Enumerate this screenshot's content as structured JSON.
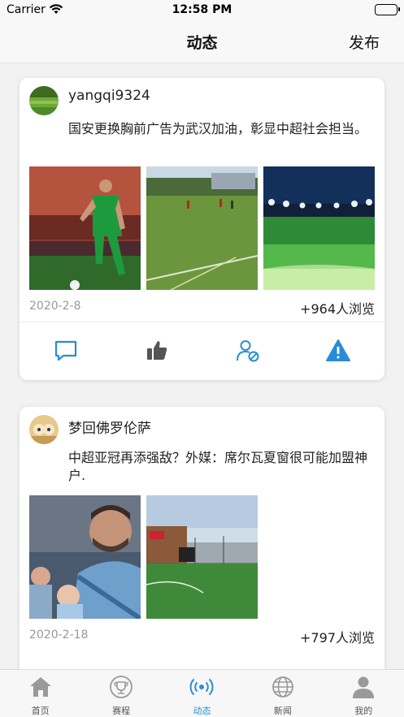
{
  "status_bar": {
    "carrier": "Carrier",
    "time": "12:58 PM"
  },
  "nav": {
    "title": "动态",
    "publish_label": "发布"
  },
  "posts": [
    {
      "username": "yangqi9324",
      "text": "国安更换胸前广告为武汉加油，彰显中超社会担当。",
      "date": "2020-2-8",
      "views": "+964人浏览",
      "image_count": 3
    },
    {
      "username": "梦回佛罗伦萨",
      "text": "中超亚冠再添强敌？外媒：席尔瓦夏窗很可能加盟神户.",
      "date": "2020-2-18",
      "views": "+797人浏览",
      "image_count": 2
    }
  ],
  "actions": [
    "comment-icon",
    "thumbs-up-icon",
    "block-user-icon",
    "warning-icon"
  ],
  "tabs": [
    {
      "label": "首页",
      "icon": "home-icon"
    },
    {
      "label": "赛程",
      "icon": "trophy-icon"
    },
    {
      "label": "动态",
      "icon": "broadcast-icon",
      "active": true
    },
    {
      "label": "新闻",
      "icon": "globe-icon"
    },
    {
      "label": "我的",
      "icon": "user-icon"
    }
  ],
  "colors": {
    "accent": "#2a8cd8",
    "inactive_tab": "#9a9a9a",
    "warning": "#2a8cd8"
  }
}
